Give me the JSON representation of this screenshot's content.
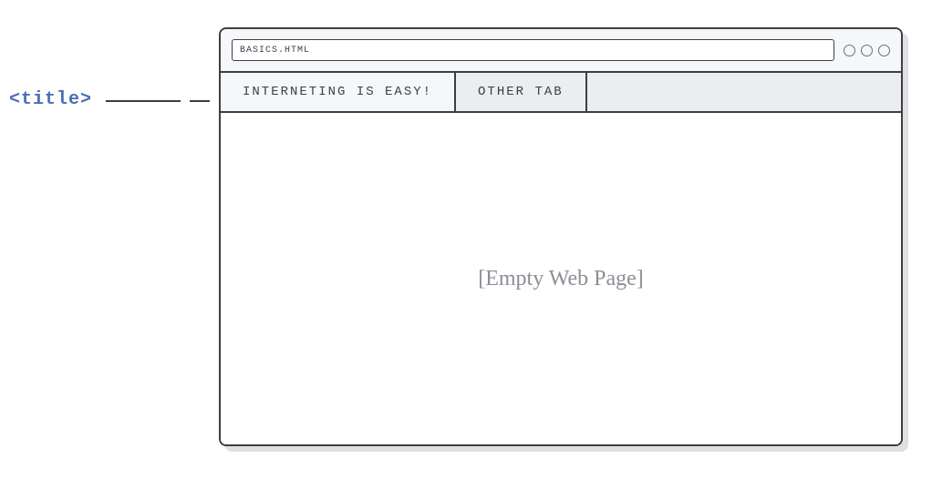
{
  "annotation": {
    "label": "<title>"
  },
  "browser": {
    "url": "BASICS.HTML",
    "tabs": [
      {
        "label": "INTERNETING IS EASY!",
        "active": true
      },
      {
        "label": "OTHER TAB",
        "active": false
      }
    ],
    "viewport_placeholder": "[Empty Web Page]"
  }
}
